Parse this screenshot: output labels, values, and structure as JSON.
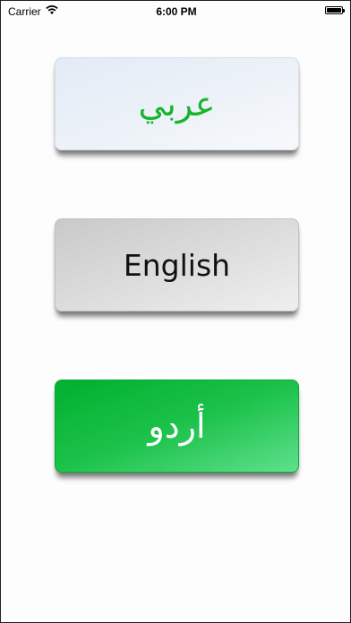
{
  "status_bar": {
    "carrier": "Carrier",
    "time": "6:00 PM"
  },
  "languages": {
    "arabic_label": "عربي",
    "english_label": "English",
    "urdu_label": "أردو"
  },
  "colors": {
    "arabic_text": "#16b52f",
    "english_text": "#111111",
    "urdu_bg": "#00b02e",
    "urdu_text": "#ffffff"
  }
}
